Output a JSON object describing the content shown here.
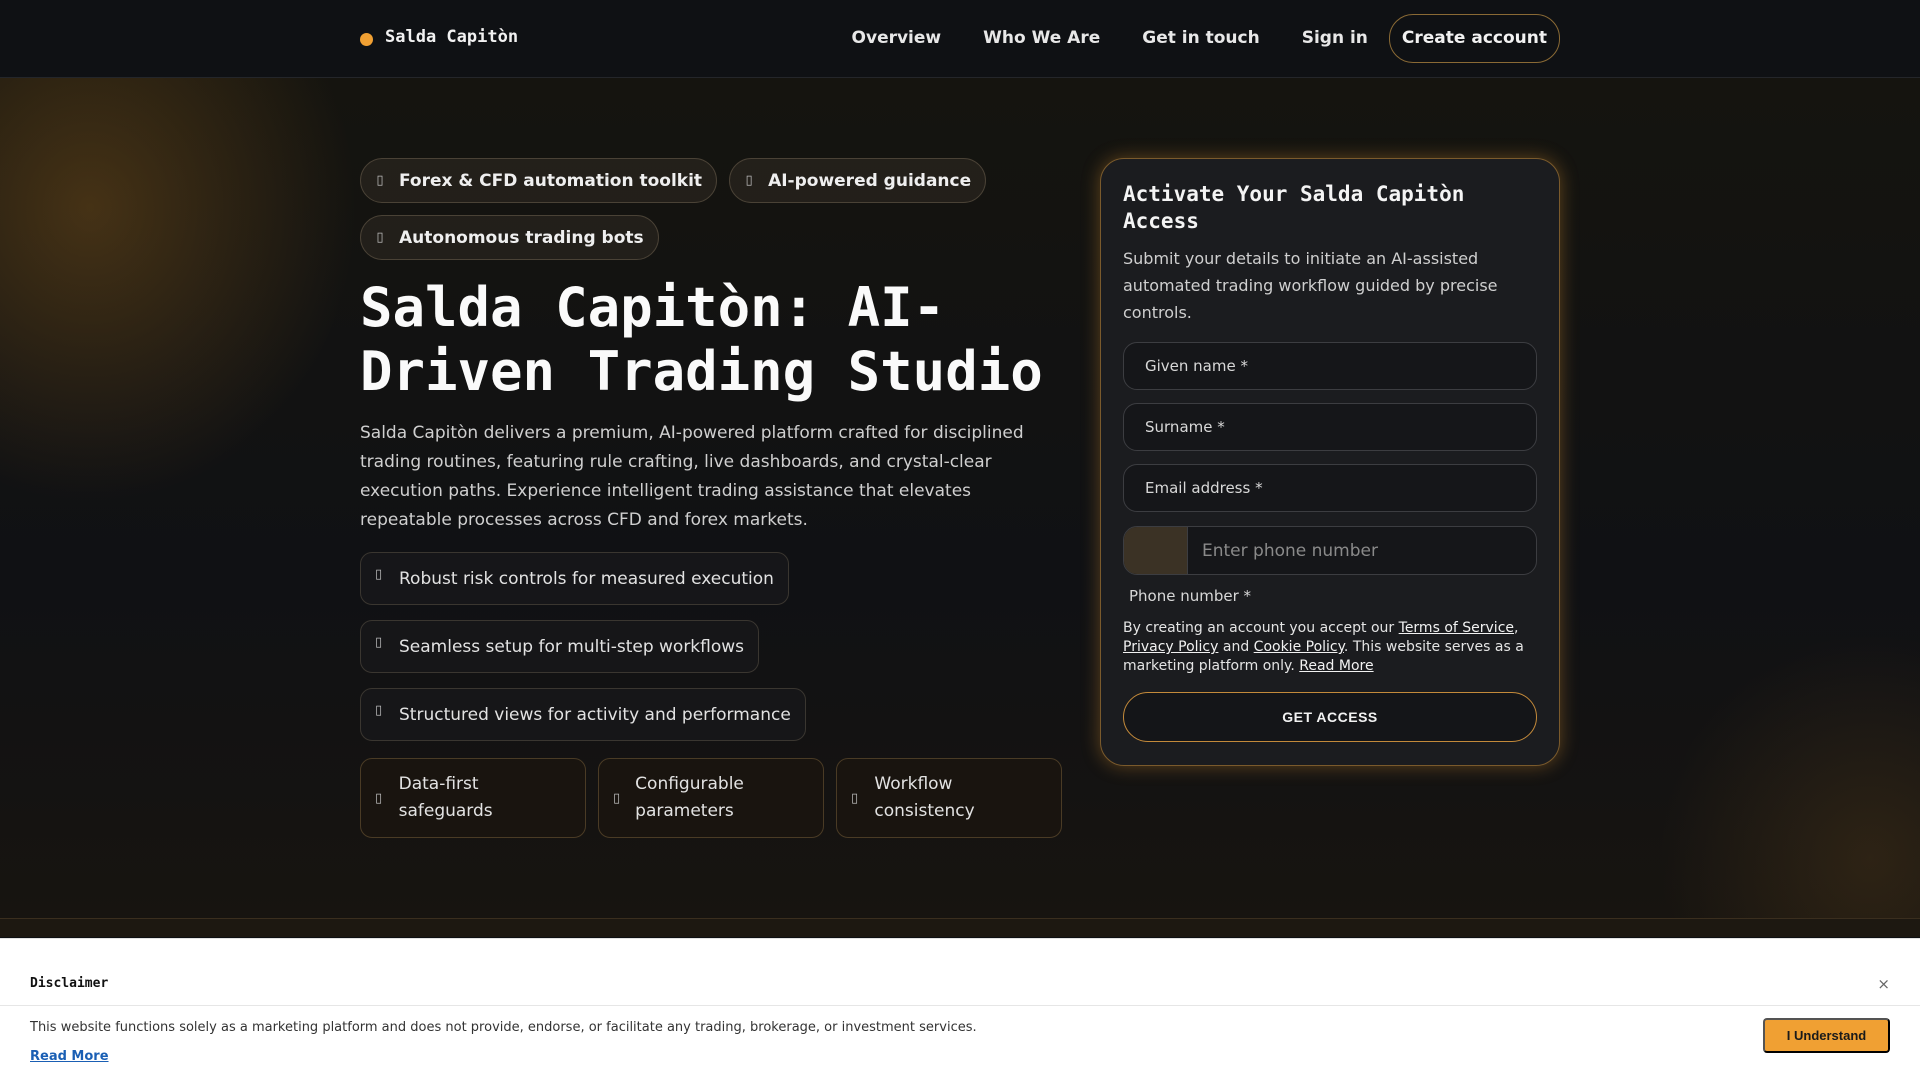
{
  "nav": {
    "brand": "Salda Capitòn",
    "links": [
      "Overview",
      "Who We Are",
      "Get in touch",
      "Sign in"
    ],
    "cta": "Create account"
  },
  "hero": {
    "pills": [
      {
        "icon": "chart-icon",
        "label": "Forex & CFD automation toolkit"
      },
      {
        "icon": "spark-icon",
        "label": "AI-powered guidance"
      },
      {
        "icon": "robot-icon",
        "label": "Autonomous trading bots"
      }
    ],
    "title": "Salda Capitòn: AI-Driven Trading Studio",
    "description": "Salda Capitòn delivers a premium, AI-powered platform crafted for disciplined trading routines, featuring rule crafting, live dashboards, and crystal-clear execution paths. Experience intelligent trading assistance that elevates repeatable processes across CFD and forex markets.",
    "features": [
      "Robust risk controls for measured execution",
      "Seamless setup for multi-step workflows",
      "Structured views for activity and performance"
    ],
    "tiles": [
      "Data-first safeguards",
      "Configurable parameters",
      "Workflow consistency"
    ]
  },
  "form": {
    "title": "Activate Your Salda Capitòn Access",
    "subtitle": "Submit your details to initiate an AI-assisted automated trading workflow guided by precise controls.",
    "given_name": "Given name *",
    "surname": "Surname *",
    "email": "Email address *",
    "phone_placeholder": "Enter phone number",
    "phone_label": "Phone number *",
    "legal_prefix": "By creating an account you accept our",
    "terms": "Terms of Service",
    "privacy": "Privacy Policy",
    "and": "and",
    "cookie": "Cookie Policy",
    "legal_suffix": ". This website serves as a marketing platform only.",
    "read_more": "Read More",
    "submit": "GET ACCESS"
  },
  "disclaimer": {
    "title": "Disclaimer",
    "close": "×",
    "text": "This website functions solely as a marketing platform and does not provide, endorse, or facilitate any trading, brokerage, or investment services.",
    "read_more": "Read More",
    "button": "I Understand"
  },
  "colors": {
    "accent": "#f0a033",
    "background": "#0d0f12",
    "link": "#1a5fb4"
  }
}
